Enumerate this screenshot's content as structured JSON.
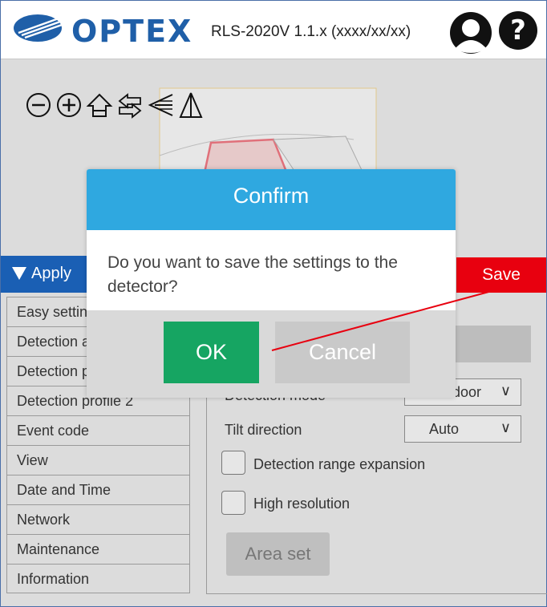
{
  "header": {
    "logo_text": "OPTEX",
    "version": "RLS-2020V 1.1.x (xxxx/xx/xx)",
    "user_icon": "user-icon",
    "help_icon": "help-icon"
  },
  "toolbar": {
    "icons": [
      "zoom-out-icon",
      "zoom-in-icon",
      "home-icon",
      "swap-arrows-icon",
      "left-direction-icon",
      "mirror-icon"
    ]
  },
  "apply_bar": {
    "apply_label": "Apply",
    "save_label": "Save"
  },
  "sidebar": {
    "items": [
      {
        "label": "Easy setting"
      },
      {
        "label": "Detection area"
      },
      {
        "label": "Detection profile 1"
      },
      {
        "label": "Detection profile 2"
      },
      {
        "label": "Event code"
      },
      {
        "label": "View"
      },
      {
        "label": "Date and Time"
      },
      {
        "label": "Network"
      },
      {
        "label": "Maintenance"
      },
      {
        "label": "Information"
      }
    ]
  },
  "settings": {
    "detection_mode_label": "Detection mode",
    "detection_mode_value": "Outdoor",
    "tilt_direction_label": "Tilt direction",
    "tilt_direction_value": "Auto",
    "range_expansion_label": "Detection range expansion",
    "range_expansion_checked": false,
    "high_resolution_label": "High resolution",
    "high_resolution_checked": false,
    "area_set_label": "Area set"
  },
  "dialog": {
    "title": "Confirm",
    "message": "Do you want to save the settings to the detector?",
    "ok_label": "OK",
    "cancel_label": "Cancel"
  },
  "colors": {
    "header_blue": "#1f5fa8",
    "apply_blue": "#1a5fb4",
    "save_red": "#e8000f",
    "dialog_blue": "#2fa8e0",
    "ok_green": "#16a562"
  }
}
